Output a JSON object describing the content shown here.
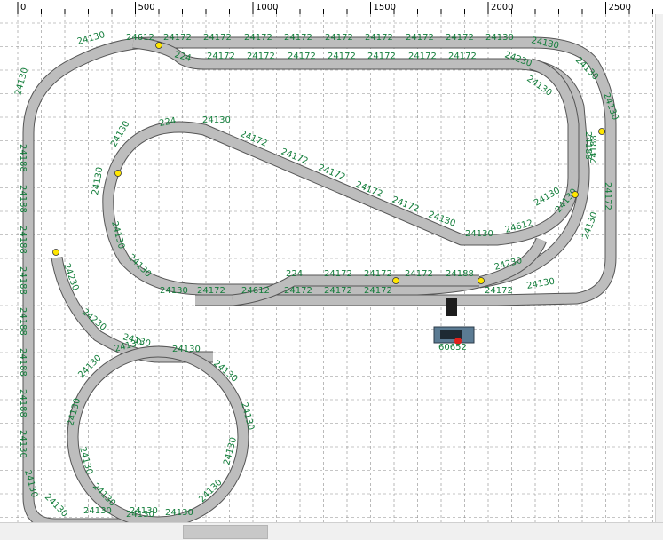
{
  "ruler": {
    "labels": [
      "0",
      "500",
      "1000",
      "1500",
      "2000",
      "2500"
    ]
  },
  "labels": [
    "24130",
    "24612",
    "24172",
    "24172",
    "24172",
    "24172",
    "24172",
    "24172",
    "24172",
    "24172",
    "24130",
    "24130",
    "224",
    "24172",
    "24172",
    "24172",
    "24172",
    "24172",
    "24172",
    "24172",
    "24230",
    "24130",
    "24130",
    "24130",
    "24188",
    "24130",
    "24188",
    "24188",
    "24188",
    "24188",
    "24188",
    "24188",
    "24188",
    "24130",
    "24130",
    "24130",
    "224",
    "24130",
    "24172",
    "24172",
    "24172",
    "24172",
    "24172",
    "24130",
    "24130",
    "24612",
    "24130",
    "24188",
    "24172",
    "24130",
    "24130",
    "24130",
    "24130",
    "24130",
    "24130",
    "24130",
    "24612",
    "224",
    "24172",
    "24172",
    "24172",
    "24188",
    "24230",
    "24172",
    "24172",
    "24172",
    "24172",
    "24172",
    "24130",
    "24230",
    "24230",
    "24130",
    "24130",
    "24130",
    "24130",
    "24130",
    "24130",
    "24130",
    "24130",
    "24130",
    "24130",
    "24130",
    "24130",
    "24130",
    "24130",
    "24130"
  ],
  "locomotive": {
    "label": "60652"
  },
  "colors": {
    "track": "#bdbdbd",
    "track_edge": "#555555",
    "label": "#127d3a",
    "signal": "#ffe600",
    "grid": "#8c8c8c"
  },
  "icons": {
    "signal": "yellow-signal-icon",
    "locomotive": "locomotive-icon",
    "buffer": "buffer-stop-icon"
  }
}
